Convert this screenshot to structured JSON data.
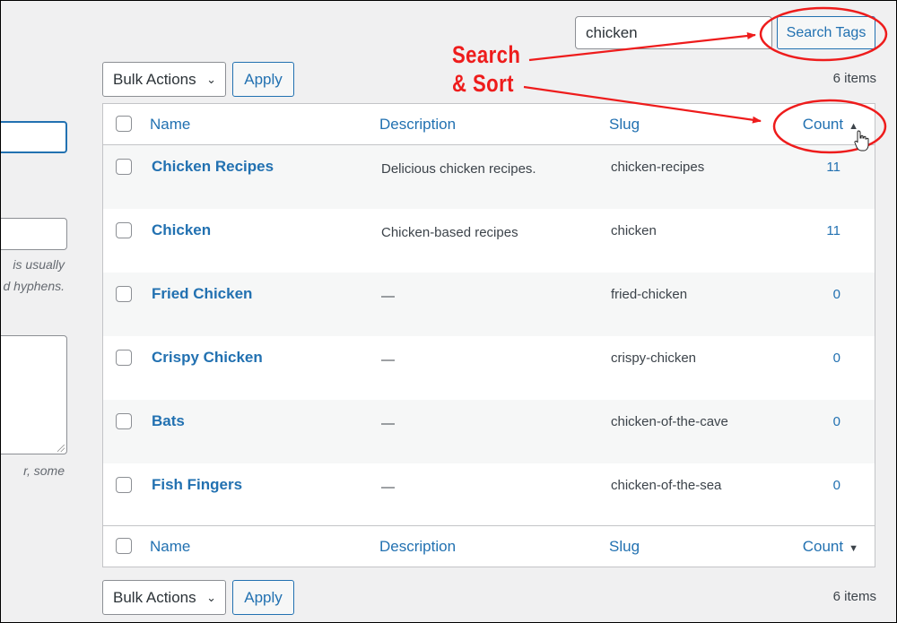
{
  "left_form": {
    "help_text_1a": "is usually",
    "help_text_1b": "d hyphens.",
    "help_text_2": "r, some"
  },
  "search": {
    "value": "chicken",
    "button_label": "Search Tags"
  },
  "top_nav": {
    "bulk_actions_label": "Bulk Actions",
    "apply_label": "Apply",
    "items_count": "6 items"
  },
  "bottom_nav": {
    "bulk_actions_label": "Bulk Actions",
    "apply_label": "Apply",
    "items_count": "6 items"
  },
  "table": {
    "columns": {
      "name": "Name",
      "description": "Description",
      "slug": "Slug",
      "count": "Count"
    },
    "sort": {
      "column": "count",
      "header_arrow": "▲",
      "footer_arrow": "▼"
    },
    "rows": [
      {
        "name": "Chicken Recipes",
        "description": "Delicious chicken recipes.",
        "slug": "chicken-recipes",
        "count": "11"
      },
      {
        "name": "Chicken",
        "description": "Chicken-based recipes",
        "slug": "chicken",
        "count": "11"
      },
      {
        "name": "Fried Chicken",
        "description": "—",
        "slug": "fried-chicken",
        "count": "0"
      },
      {
        "name": "Crispy Chicken",
        "description": "—",
        "slug": "crispy-chicken",
        "count": "0"
      },
      {
        "name": "Bats",
        "description": "—",
        "slug": "chicken-of-the-cave",
        "count": "0"
      },
      {
        "name": "Fish Fingers",
        "description": "—",
        "slug": "chicken-of-the-sea",
        "count": "0"
      }
    ]
  },
  "annotation": {
    "line1": "Search",
    "line2": "& Sort",
    "color": "#ee1c1c"
  }
}
